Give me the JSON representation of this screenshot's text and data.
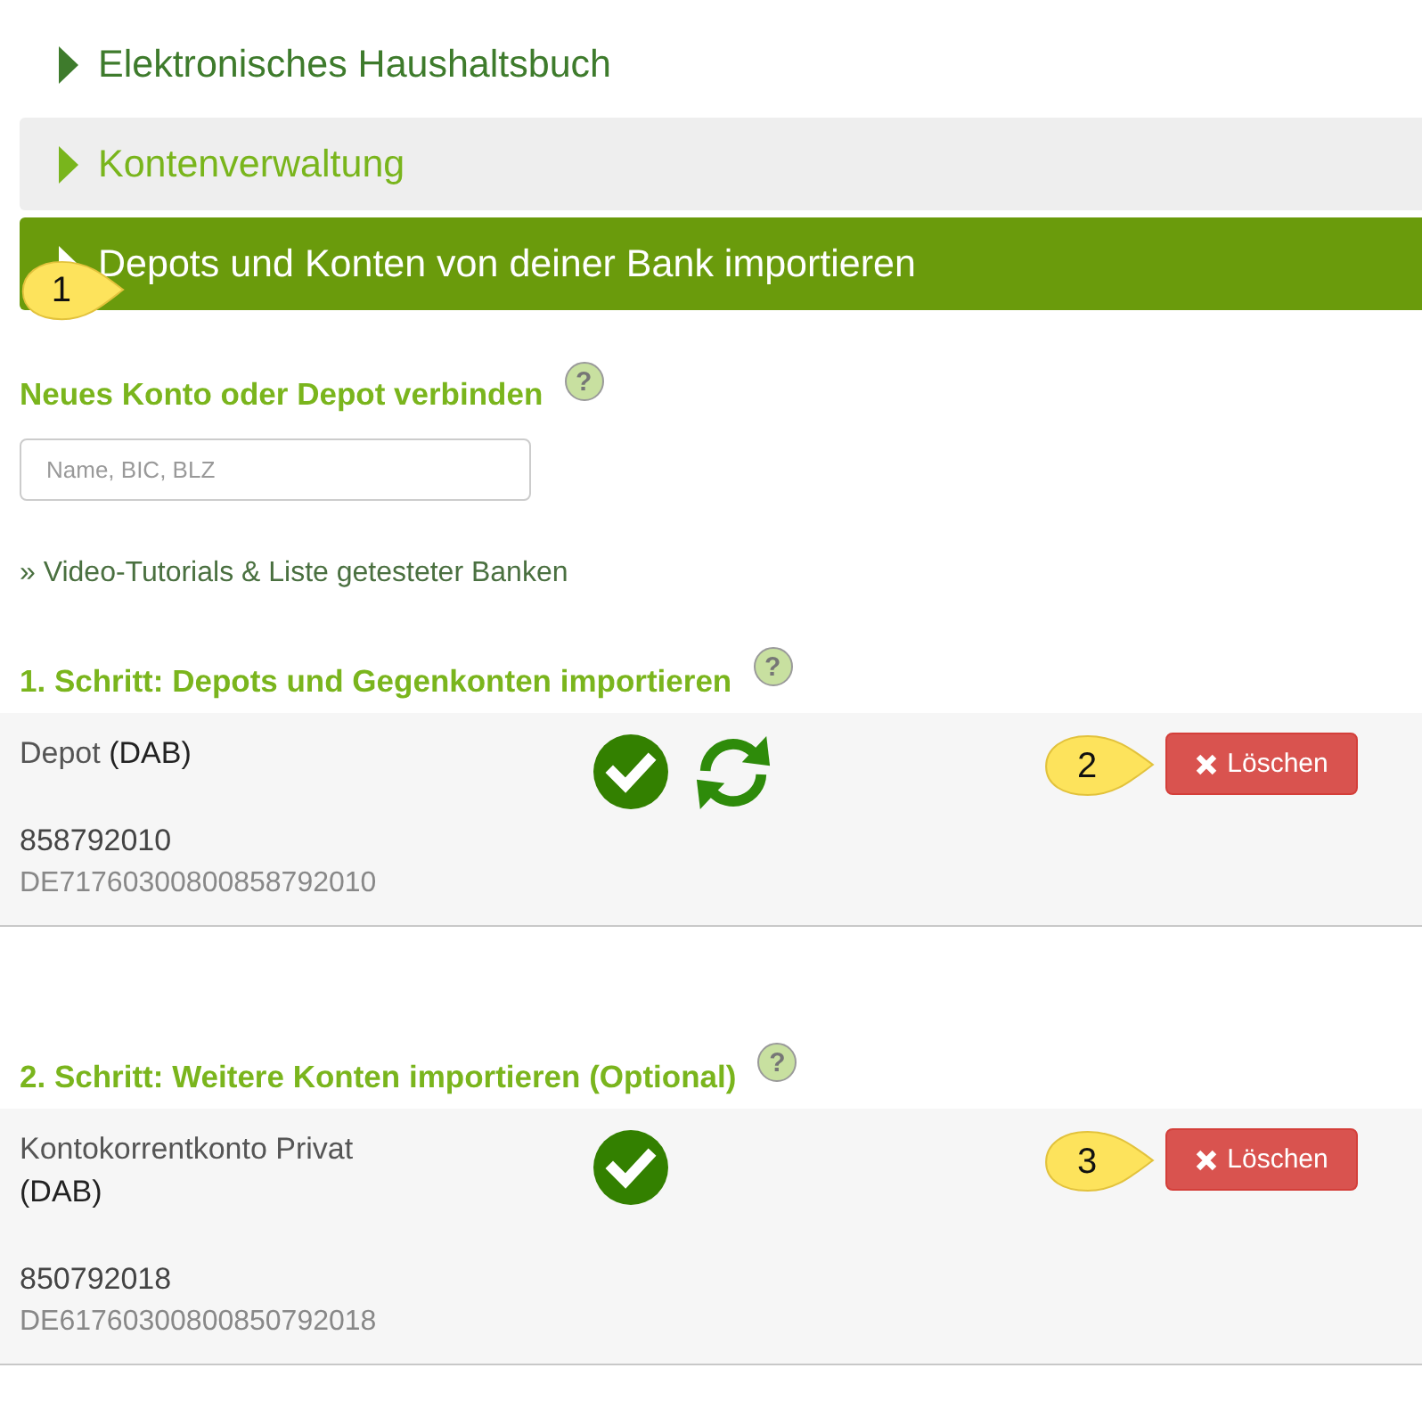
{
  "accordion": [
    {
      "title": "Elektronisches Haushaltsbuch",
      "selected": false,
      "highlighted": false
    },
    {
      "title": "Kontenverwaltung",
      "selected": false,
      "highlighted": true
    },
    {
      "title": "Depots und Konten von deiner Bank importieren",
      "selected": true,
      "highlighted": false,
      "callout": "1"
    }
  ],
  "connect": {
    "heading": "Neues Konto oder Depot verbinden",
    "help": "?",
    "search": {
      "placeholder": "Name, BIC, BLZ"
    },
    "link": "» Video-Tutorials & Liste getesteter Banken"
  },
  "steps": [
    {
      "heading": "1. Schritt: Depots und Gegenkonten importieren",
      "help": "?",
      "accounts": [
        {
          "name": "Depot",
          "bank": "(DAB)",
          "number": "858792010",
          "iban": "DE71760300800858792010",
          "connected": true,
          "syncable": true,
          "delete_label": "Löschen",
          "callout": "2"
        }
      ]
    },
    {
      "heading": "2. Schritt: Weitere Konten importieren (Optional)",
      "help": "?",
      "accounts": [
        {
          "name": "Kontokorrentkonto Privat",
          "bank": "(DAB)",
          "number": "850792018",
          "iban": "DE61760300800850792018",
          "connected": true,
          "syncable": false,
          "delete_label": "Löschen",
          "callout": "3"
        }
      ]
    }
  ]
}
